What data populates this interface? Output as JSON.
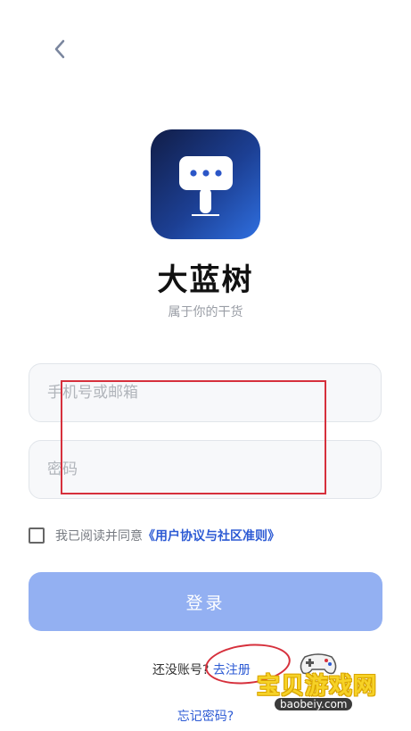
{
  "app": {
    "name": "大蓝树",
    "slogan": "属于你的干货"
  },
  "form": {
    "phone_placeholder": "手机号或邮箱",
    "password_placeholder": "密码",
    "agree_prefix": "我已阅读并同意",
    "agree_link": "《用户协议与社区准则》",
    "agree_checked": false,
    "login_label": "登录"
  },
  "footer": {
    "no_account": "还没账号?",
    "register_link": "去注册",
    "forgot_link": "忘记密码?"
  },
  "watermark": {
    "title": "宝贝游戏网",
    "url": "baobeiy.com"
  },
  "colors": {
    "accent": "#2d5bd4",
    "login_button": "#93b0f2",
    "logo_gradient_start": "#111d47",
    "logo_gradient_end": "#2f6fe0",
    "annotation_red": "#d6303c"
  },
  "icons": {
    "back": "chevron-left-icon",
    "logo": "chat-bubble-icon",
    "watermark_icon": "gamepad-icon"
  }
}
